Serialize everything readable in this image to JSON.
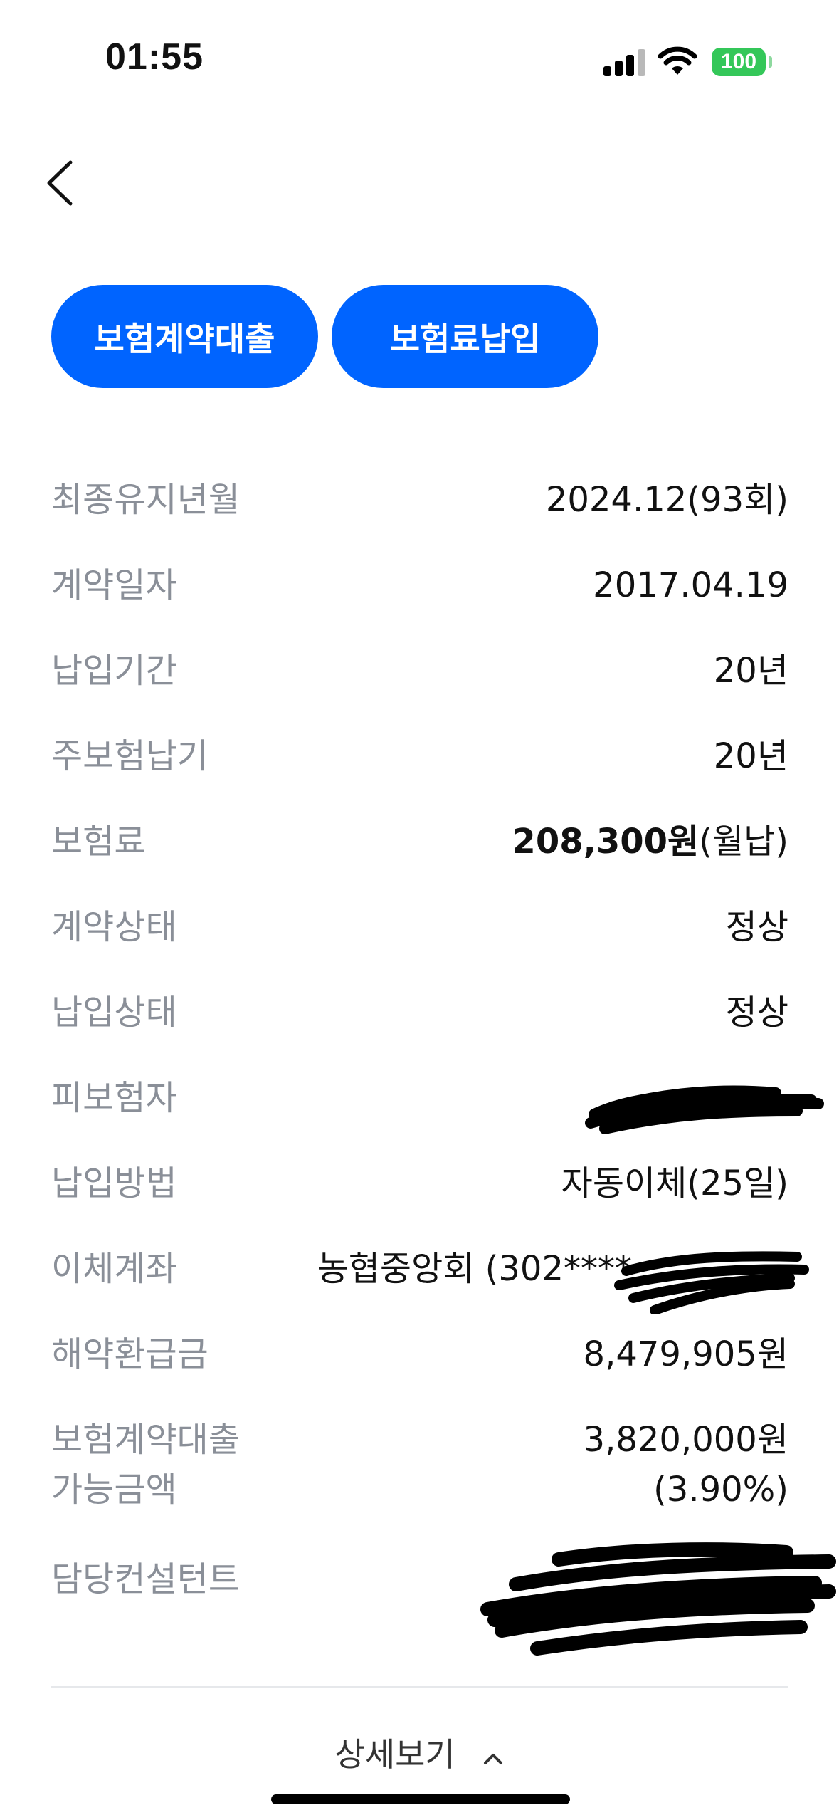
{
  "status_bar": {
    "time": "01:55",
    "battery": "100"
  },
  "actions": {
    "loan_button": "보험계약대출",
    "pay_button": "보험료납입"
  },
  "info": {
    "last_maintained_label": "최종유지년월",
    "last_maintained_value": "2024.12(93회)",
    "contract_date_label": "계약일자",
    "contract_date_value": "2017.04.19",
    "payment_period_label": "납입기간",
    "payment_period_value": "20년",
    "main_insurance_label": "주보험납기",
    "main_insurance_value": "20년",
    "premium_label": "보험료",
    "premium_amount": "208,300원",
    "premium_cycle": "(월납)",
    "contract_status_label": "계약상태",
    "contract_status_value": "정상",
    "payment_status_label": "납입상태",
    "payment_status_value": "정상",
    "insured_label": "피보험자",
    "payment_method_label": "납입방법",
    "payment_method_value": "자동이체(25일)",
    "transfer_account_label": "이체계좌",
    "transfer_account_value": "농협중앙회 (302****",
    "surrender_label": "해약환급금",
    "surrender_value": "8,479,905원",
    "loan_available_label_line1": "보험계약대출",
    "loan_available_label_line2": "가능금액",
    "loan_available_amount": "3,820,000원",
    "loan_available_rate": "(3.90%)",
    "consultant_label": "담당컨설턴트"
  },
  "footer": {
    "detail_label": "상세보기"
  },
  "colors": {
    "accent": "#0064ff",
    "label_gray": "#8a8f98",
    "battery_green": "#34c759"
  }
}
